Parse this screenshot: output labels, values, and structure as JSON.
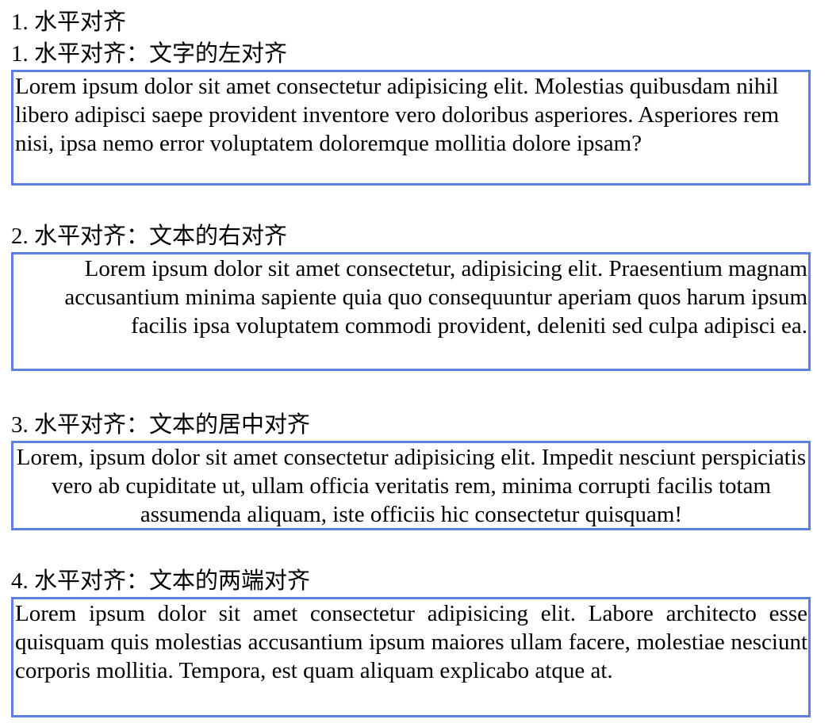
{
  "page": {
    "heading": "1. 水平对齐"
  },
  "sections": [
    {
      "title": "1. 水平对齐：文字的左对齐",
      "alignment": "left",
      "text": "Lorem ipsum dolor sit amet consectetur adipisicing elit. Molestias quibusdam nihil libero adipisci saepe provident inventore vero doloribus asperiores. Asperiores rem nisi, ipsa nemo error voluptatem doloremque mollitia dolore ipsam?"
    },
    {
      "title": "2. 水平对齐：文本的右对齐",
      "alignment": "right",
      "text": "Lorem ipsum dolor sit amet consectetur, adipisicing elit. Praesentium magnam accusantium minima sapiente quia quo consequuntur aperiam quos harum ipsum facilis ipsa voluptatem commodi provident, deleniti sed culpa adipisci ea."
    },
    {
      "title": "3. 水平对齐：文本的居中对齐",
      "alignment": "center",
      "text": "Lorem, ipsum dolor sit amet consectetur adipisicing elit. Impedit nesciunt perspiciatis vero ab cupiditate ut, ullam officia veritatis rem, minima corrupti facilis totam assumenda aliquam, iste officiis hic consectetur quisquam!"
    },
    {
      "title": "4. 水平对齐：文本的两端对齐",
      "alignment": "justify",
      "text": "Lorem ipsum dolor sit amet consectetur adipisicing elit. Labore architecto esse quisquam quis molestias accusantium ipsum maiores ullam facere, molestiae nesciunt corporis mollitia. Tempora, est quam aliquam explicabo atque at."
    }
  ],
  "colors": {
    "border": "#5b7fe3",
    "text": "#000000",
    "background": "#ffffff"
  }
}
